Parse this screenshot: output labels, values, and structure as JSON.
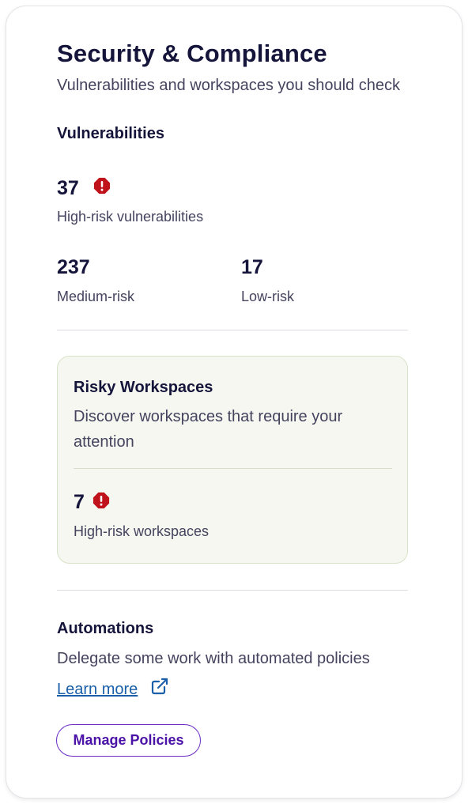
{
  "header": {
    "title": "Security & Compliance",
    "subtitle": "Vulnerabilities and workspaces you should check"
  },
  "vulnerabilities": {
    "heading": "Vulnerabilities",
    "high": {
      "value": "37",
      "label": "High-risk vulnerabilities",
      "icon": "alert-octagon-icon"
    },
    "medium": {
      "value": "237",
      "label": "Medium-risk"
    },
    "low": {
      "value": "17",
      "label": "Low-risk"
    }
  },
  "risky_workspaces": {
    "heading": "Risky Workspaces",
    "description": "Discover workspaces that require your attention",
    "high": {
      "value": "7",
      "label": "High-risk workspaces",
      "icon": "alert-octagon-icon"
    }
  },
  "automations": {
    "heading": "Automations",
    "description": "Delegate some work with automated policies",
    "learn_more": "Learn more",
    "learn_more_icon": "external-link-icon",
    "button_label": "Manage Policies"
  },
  "colors": {
    "text_primary": "#15143a",
    "text_secondary": "#45435e",
    "risk_red": "#c0121b",
    "link_blue": "#1a5fa8",
    "button_purple": "#4b12a8",
    "panel_bg": "#f5f7f0"
  }
}
